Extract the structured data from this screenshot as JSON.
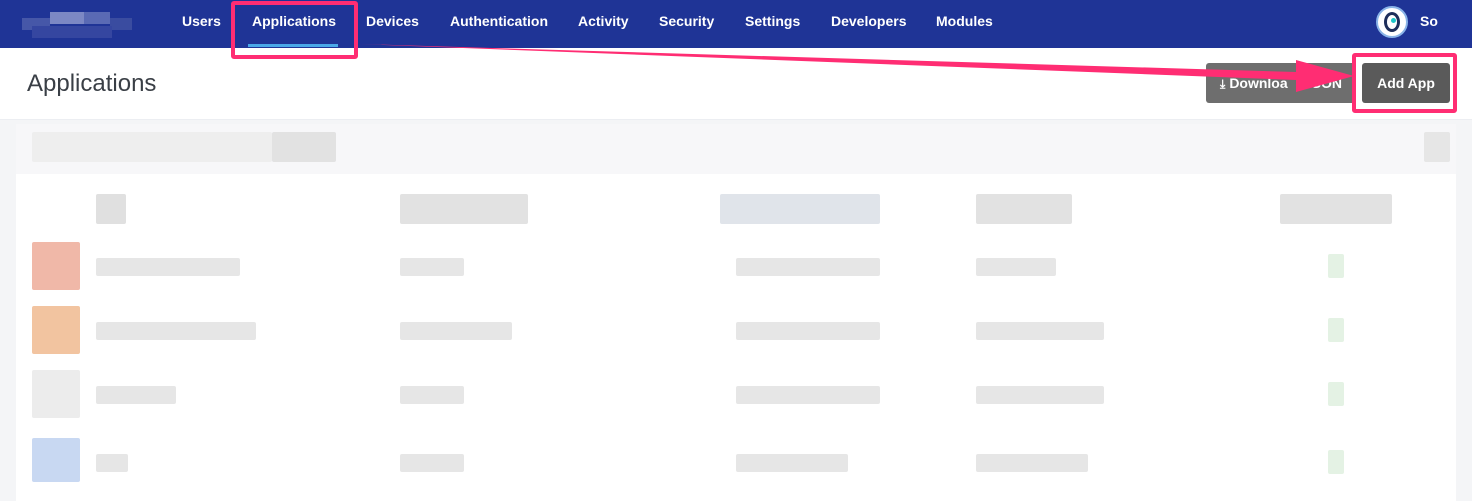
{
  "brand": {
    "logo_name": "company-logo"
  },
  "nav": {
    "items": [
      {
        "label": "Users"
      },
      {
        "label": "Applications",
        "active": true
      },
      {
        "label": "Devices"
      },
      {
        "label": "Authentication"
      },
      {
        "label": "Activity"
      },
      {
        "label": "Security"
      },
      {
        "label": "Settings"
      },
      {
        "label": "Developers"
      },
      {
        "label": "Modules"
      }
    ],
    "user_name": "So",
    "avatar_icon": "user-avatar-icon"
  },
  "page": {
    "title": "Applications",
    "download_label": "Downloa",
    "download_label_tail": "SON",
    "download_icon": "download-icon",
    "add_label": "Add App"
  },
  "colors": {
    "nav_bg": "#1f3496",
    "active_underline": "#4aa8e8",
    "annotation": "#ff2d73",
    "button_bg": "#5a5a5a"
  },
  "annotation": {
    "highlighted": [
      "nav-item-applications",
      "add-app-button"
    ],
    "arrow_from": "nav-item-applications",
    "arrow_to": "add-app-button"
  },
  "table": {
    "blurred": true,
    "visible_rows": 4
  }
}
